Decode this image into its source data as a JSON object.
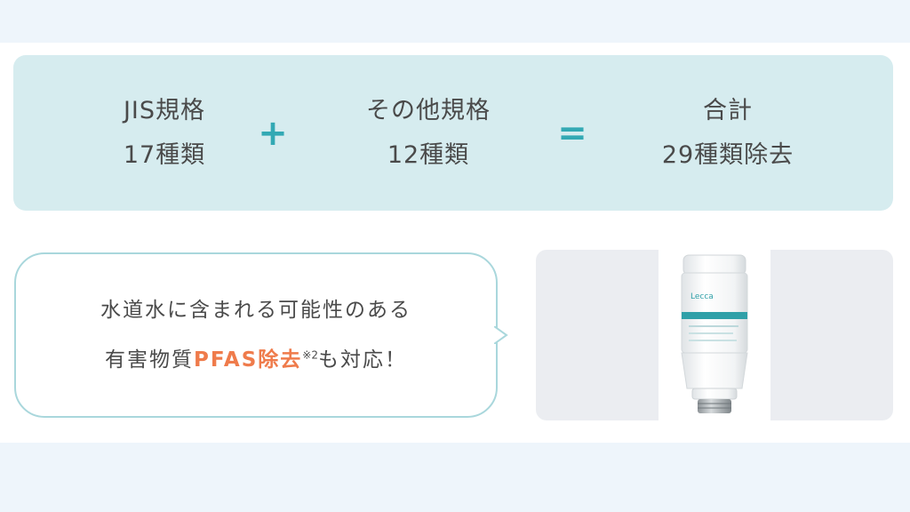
{
  "summary": {
    "left": {
      "line1": "JIS規格",
      "line2": "17種類"
    },
    "plus": "+",
    "middle": {
      "line1": "その他規格",
      "line2": "12種類"
    },
    "equals": "=",
    "right": {
      "line1": "合計",
      "line2": "29種類除去"
    }
  },
  "bubble": {
    "line1": "水道水に含まれる可能性のある",
    "line2_prefix": "有害物質",
    "line2_highlight": "PFAS除去",
    "line2_note": "※2",
    "line2_suffix": "も対応！"
  },
  "product": {
    "brand_label": "Lecca",
    "icon": "water-filter-cartridge-icon"
  },
  "colors": {
    "page_background": "#eef5fb",
    "summary_background": "#d6ecef",
    "operator": "#33a9b4",
    "bubble_border": "#a9d7dc",
    "highlight": "#ef7b4b",
    "product_accent": "#2fa0a8"
  }
}
